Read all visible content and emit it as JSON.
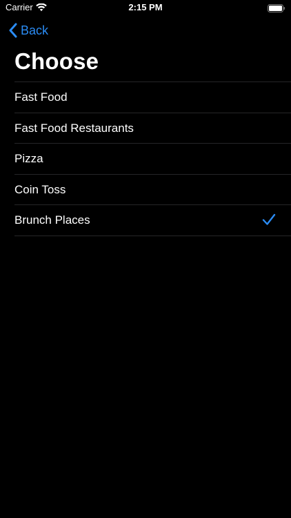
{
  "status_bar": {
    "carrier": "Carrier",
    "time": "2:15 PM",
    "wifi_icon": "wifi-icon",
    "battery_icon": "battery-icon"
  },
  "nav": {
    "back_label": "Back",
    "back_icon": "chevron-left-icon",
    "title": "Choose"
  },
  "list": {
    "items": [
      {
        "label": "Fast Food",
        "selected": false
      },
      {
        "label": "Fast Food Restaurants",
        "selected": false
      },
      {
        "label": "Pizza",
        "selected": false
      },
      {
        "label": "Coin Toss",
        "selected": false
      },
      {
        "label": "Brunch Places",
        "selected": true
      }
    ],
    "checkmark_icon": "checkmark-icon"
  },
  "colors": {
    "background": "#000000",
    "accent": "#2b8cf4",
    "separator": "#262628",
    "text": "#ffffff"
  }
}
